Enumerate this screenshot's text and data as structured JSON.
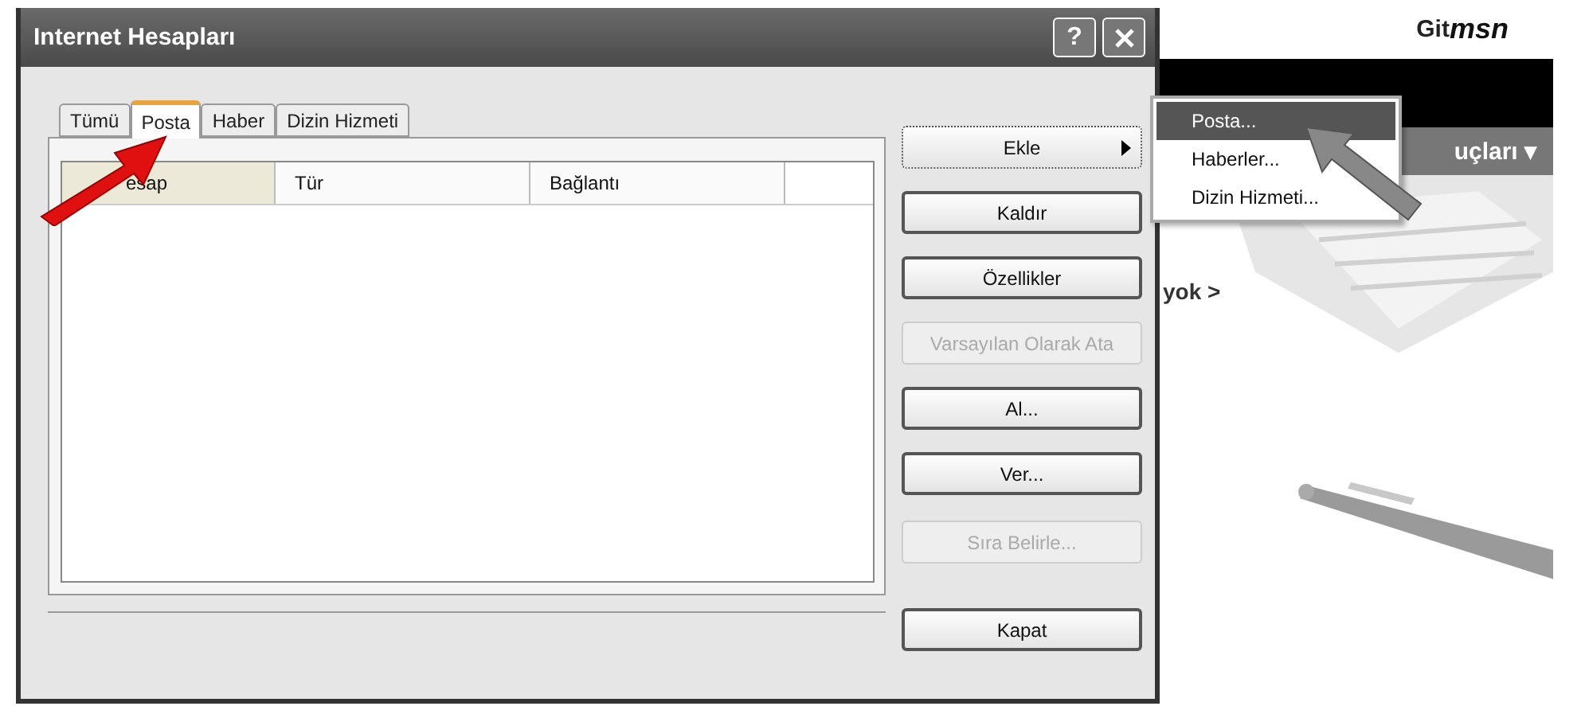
{
  "window": {
    "title": "Internet Hesapları",
    "help_label": "?"
  },
  "tabs": [
    {
      "label": "Tümü",
      "selected": false
    },
    {
      "label": "Posta",
      "selected": true
    },
    {
      "label": "Haber",
      "selected": false
    },
    {
      "label": "Dizin Hizmeti",
      "selected": false
    }
  ],
  "list": {
    "columns": [
      {
        "label": "esap",
        "sorted": true
      },
      {
        "label": "Tür",
        "sorted": false
      },
      {
        "label": "Bağlantı",
        "sorted": false
      }
    ]
  },
  "buttons": [
    {
      "label": "Ekle",
      "kind": "submenu",
      "disabled": false
    },
    {
      "label": "Kaldır",
      "kind": "plain",
      "disabled": false
    },
    {
      "label": "Özellikler",
      "kind": "plain",
      "disabled": false
    },
    {
      "label": "Varsayılan Olarak Ata",
      "kind": "plain",
      "disabled": true
    },
    {
      "label": "Al...",
      "kind": "plain",
      "disabled": false
    },
    {
      "label": "Ver...",
      "kind": "plain",
      "disabled": false
    },
    {
      "label": "Sıra Belirle...",
      "kind": "plain",
      "disabled": true
    }
  ],
  "close_button": "Kapat",
  "menu": {
    "items": [
      {
        "label": "Posta...",
        "selected": true
      },
      {
        "label": "Haberler...",
        "selected": false
      },
      {
        "label": "Dizin Hizmeti...",
        "selected": false
      }
    ]
  },
  "web_page": {
    "logo_prefix": "Git",
    "logo_brand": "msn",
    "nav_text": "uçları ▾",
    "body_text": "yok >"
  }
}
